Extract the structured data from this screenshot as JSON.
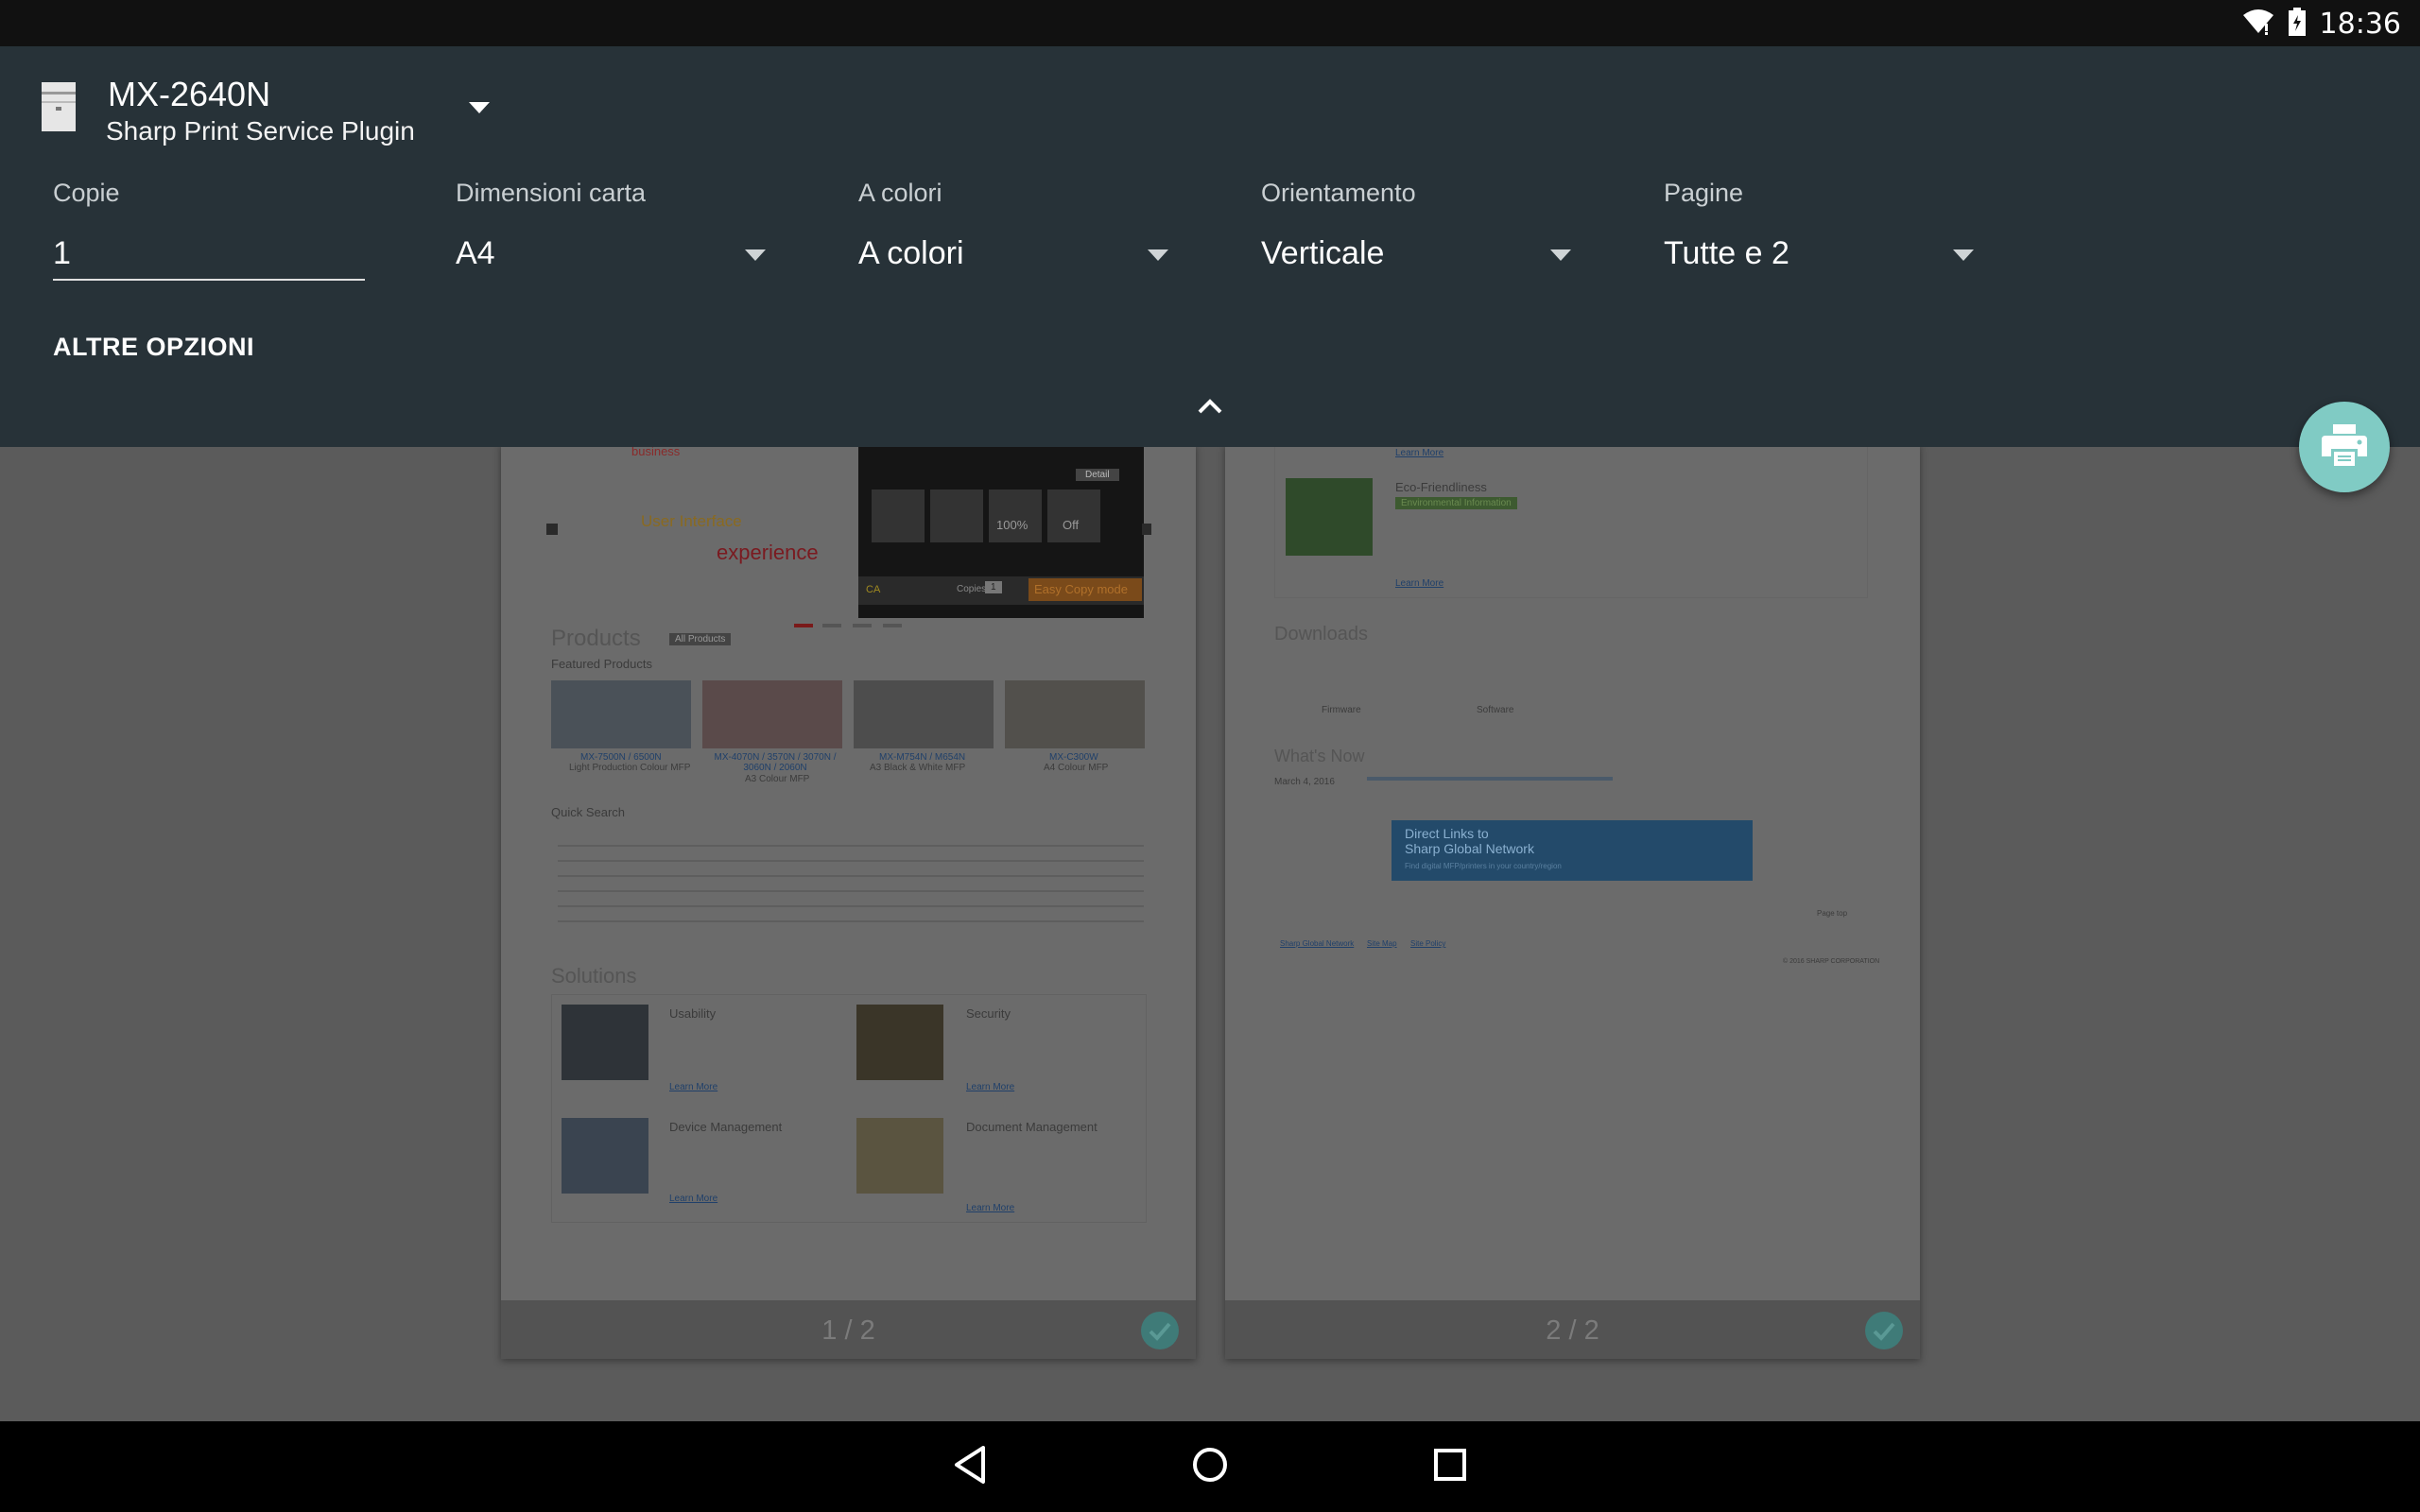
{
  "status_bar": {
    "time": "18:36",
    "icons": [
      "wifi-icon",
      "battery-charging-icon"
    ]
  },
  "printer": {
    "name": "MX-2640N",
    "service": "Sharp Print Service Plugin"
  },
  "options": {
    "copies": {
      "label": "Copie",
      "value": "1"
    },
    "paper_size": {
      "label": "Dimensioni carta",
      "value": "A4"
    },
    "color": {
      "label": "A colori",
      "value": "A colori"
    },
    "orientation": {
      "label": "Orientamento",
      "value": "Verticale"
    },
    "pages": {
      "label": "Pagine",
      "value": "Tutte e 2"
    }
  },
  "more_options_label": "ALTRE OPZIONI",
  "preview": {
    "page1": {
      "number": "1 / 2",
      "texts": {
        "business": "business",
        "ui": "User Interface",
        "experience": "experience",
        "products": "Products",
        "all_products": "All Products",
        "featured": "Featured Products",
        "prod1": "MX-7500N / 6500N",
        "prod1_sub": "Light Production Colour MFP",
        "prod2": "MX-4070N / 3570N / 3070N / 3060N / 2060N",
        "prod2_sub": "A3 Colour MFP",
        "prod3": "MX-M754N / M654N",
        "prod3_sub": "A3 Black & White MFP",
        "prod4": "MX-C300W",
        "prod4_sub": "A4 Colour MFP",
        "quick_search": "Quick Search",
        "solutions": "Solutions",
        "usability": "Usability",
        "security": "Security",
        "device_mgmt": "Device Management",
        "doc_mgmt": "Document Management",
        "learn_more": "Learn More",
        "easy_copy": "Easy Copy mode",
        "detail": "Detail",
        "zoom": "100%",
        "off": "Off",
        "ca": "CA",
        "copies": "Copies",
        "copies_val": "1"
      }
    },
    "page2": {
      "number": "2 / 2",
      "texts": {
        "learn_more": "Learn More",
        "eco": "Eco-Friendliness",
        "eco_badge": "Environmental Information",
        "downloads": "Downloads",
        "firmware": "Firmware",
        "software": "Software",
        "whats_new": "What's Now",
        "news_date": "March 4, 2016",
        "direct_links": "Direct Links to",
        "global_network": "Sharp Global Network",
        "find": "Find digital MFP/printers in your country/region",
        "page_top": "Page top",
        "sgn": "Sharp Global Network",
        "site_map": "Site Map",
        "site_policy": "Site Policy",
        "copyright": "© 2016 SHARP CORPORATION"
      }
    }
  },
  "colors": {
    "panel": "#273238",
    "fab": "#80cbc4",
    "statusbar": "#111111",
    "scrim": "#5b5b5b"
  }
}
